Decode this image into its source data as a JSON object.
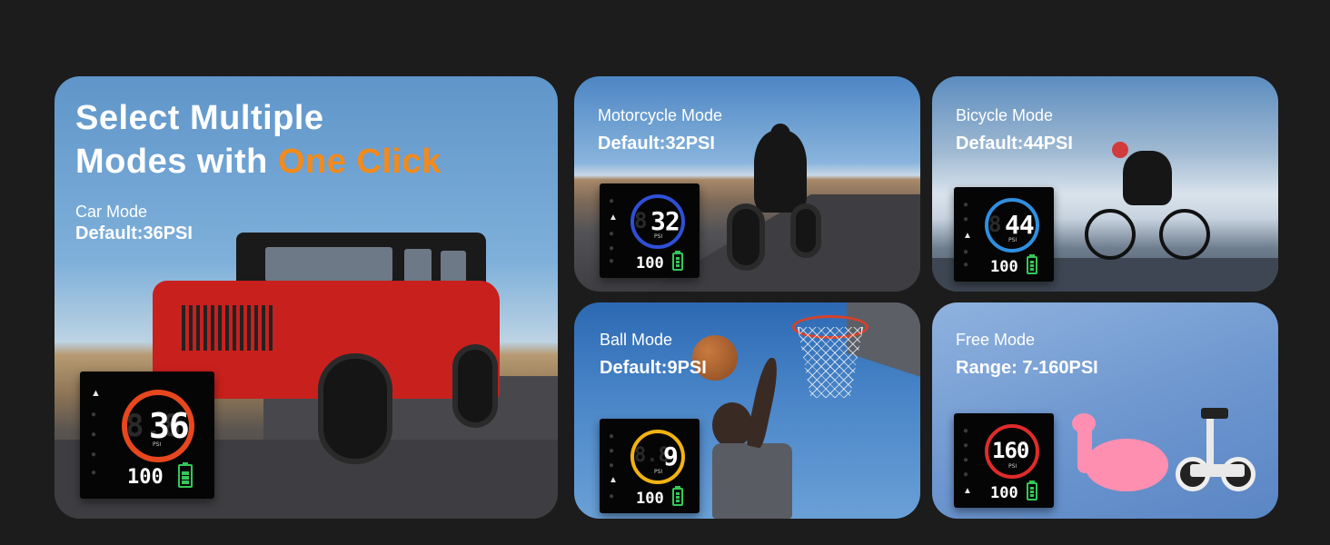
{
  "headline": {
    "line1": "Select Multiple",
    "line2_prefix": "Modes with ",
    "accent": "One Click"
  },
  "colors": {
    "background": "#1c1c1c",
    "accent": "#f28a1c",
    "battery": "#34c759"
  },
  "cards": {
    "car": {
      "name": "Car Mode",
      "value": "Default:36PSI",
      "display": {
        "reading": "36",
        "bottom": "100",
        "unit": "PSI",
        "ring_color": "#e8471e",
        "ghost": "8.8"
      }
    },
    "moto": {
      "name": "Motorcycle Mode",
      "value": "Default:32PSI",
      "display": {
        "reading": "32",
        "bottom": "100",
        "unit": "PSI",
        "ring_color": "#2f4fd6",
        "ghost": "8"
      }
    },
    "bike": {
      "name": "Bicycle Mode",
      "value": "Default:44PSI",
      "display": {
        "reading": "44",
        "bottom": "100",
        "unit": "PSI",
        "ring_color": "#2f8fe0",
        "ghost": "8"
      }
    },
    "ball": {
      "name": "Ball Mode",
      "value": "Default:9PSI",
      "display": {
        "reading": "9",
        "bottom": "100",
        "unit": "PSI",
        "ring_color": "#f2b312",
        "ghost": "8.8"
      }
    },
    "free": {
      "name": "Free Mode",
      "value": "Range: 7-160PSI",
      "display": {
        "reading": "160",
        "bottom": "100",
        "unit": "PSI",
        "ring_color": "#e02b2b",
        "ghost": ""
      }
    }
  },
  "icons": [
    "car-icon",
    "motorcycle-icon",
    "bicycle-icon",
    "ball-icon",
    "free-mode-icon",
    "battery-icon"
  ]
}
